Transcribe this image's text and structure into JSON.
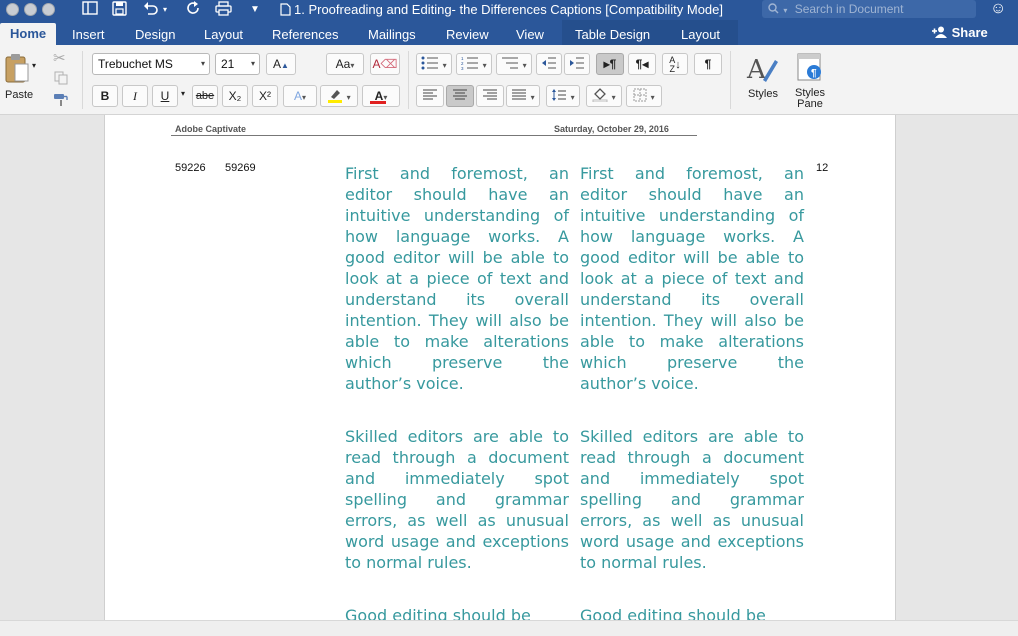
{
  "window": {
    "title": "1. Proofreading and Editing- the Differences Captions [Compatibility Mode]",
    "search_placeholder": "Search in Document"
  },
  "tabs": [
    "Home",
    "Insert",
    "Design",
    "Layout",
    "References",
    "Mailings",
    "Review",
    "View",
    "Table Design",
    "Layout"
  ],
  "active_tab": "Home",
  "share_label": "Share",
  "ribbon": {
    "paste_label": "Paste",
    "font_name": "Trebuchet MS",
    "font_size": "21",
    "bold": "B",
    "italic": "I",
    "underline": "U",
    "strikethrough": "abe",
    "subscript": "X₂",
    "superscript": "X²",
    "styles_label": "Styles",
    "styles_pane_label_1": "Styles",
    "styles_pane_label_2": "Pane"
  },
  "document": {
    "header_left": "Adobe Captivate",
    "header_right": "Saturday, October 29, 2016",
    "start_time": "59226",
    "end_time": "59269",
    "slide_number": "12",
    "captions": [
      "First and foremost, an editor should have an intuitive understanding of how language works. A good editor will be able to look at a piece of text and understand its overall intention. They will also be able to make alterations which preserve the author’s voice.",
      "Skilled editors are able to read through a document and immediately spot spelling and grammar errors, as well as unusual word usage and exceptions to normal rules.",
      "Good editing should be"
    ]
  },
  "colors": {
    "title_bar": "#2b579a",
    "caption_text": "#37999e"
  }
}
